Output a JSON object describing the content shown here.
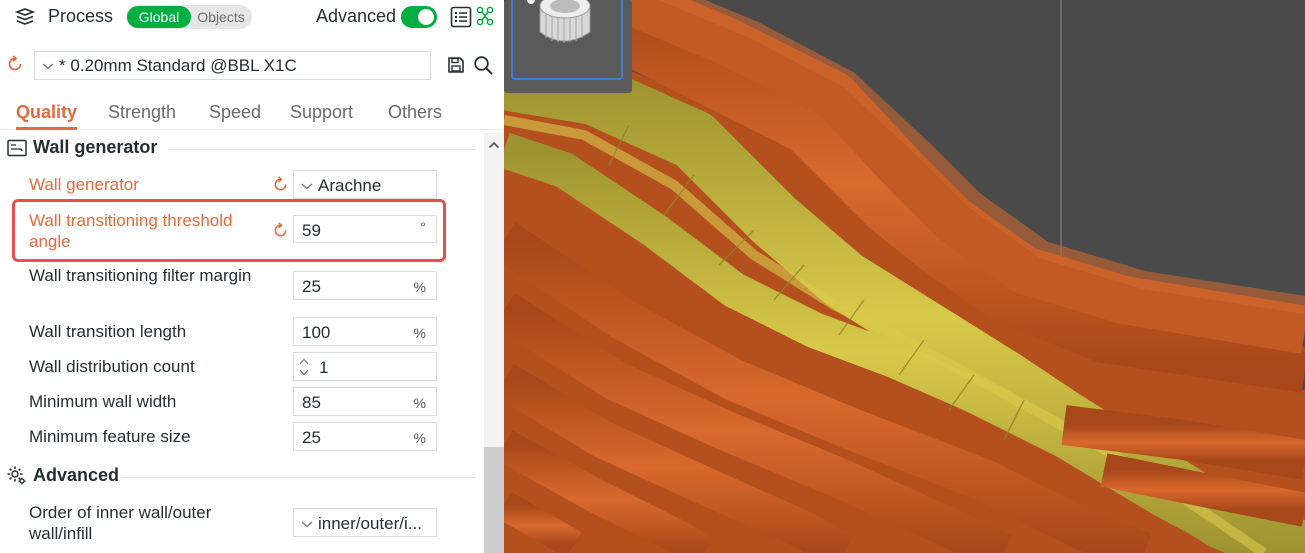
{
  "header": {
    "title": "Process",
    "scope_options": [
      "Global",
      "Objects"
    ],
    "scope_selected": "Global",
    "advanced_label": "Advanced",
    "advanced_on": true
  },
  "preset": {
    "name": "* 0.20mm Standard @BBL X1C"
  },
  "tabs": [
    {
      "label": "Quality",
      "active": true
    },
    {
      "label": "Strength",
      "active": false
    },
    {
      "label": "Speed",
      "active": false
    },
    {
      "label": "Support",
      "active": false
    },
    {
      "label": "Others",
      "active": false
    }
  ],
  "sections": {
    "wall_generator": {
      "title": "Wall generator",
      "rows": [
        {
          "label": "Wall generator",
          "value": "Arachne",
          "unit": "",
          "modified": true,
          "control": "dropdown"
        },
        {
          "label": "Wall transitioning threshold angle",
          "value": "59",
          "unit": "°",
          "modified": true,
          "control": "number"
        },
        {
          "label": "Wall transitioning filter margin",
          "value": "25",
          "unit": "%",
          "modified": false,
          "control": "number"
        },
        {
          "label": "Wall transition length",
          "value": "100",
          "unit": "%",
          "modified": false,
          "control": "number"
        },
        {
          "label": "Wall distribution count",
          "value": "1",
          "unit": "",
          "modified": false,
          "control": "spin"
        },
        {
          "label": "Minimum wall width",
          "value": "85",
          "unit": "%",
          "modified": false,
          "control": "number"
        },
        {
          "label": "Minimum feature size",
          "value": "25",
          "unit": "%",
          "modified": false,
          "control": "number"
        }
      ]
    },
    "advanced": {
      "title": "Advanced",
      "rows": [
        {
          "label": "Order of inner wall/outer wall/infill",
          "value": "inner/outer/i...",
          "unit": "",
          "modified": false,
          "control": "dropdown"
        }
      ]
    }
  },
  "colors": {
    "accent_green": "#00ae42",
    "modified_orange": "#e46a3d",
    "highlight_red": "#e84f4f",
    "outer_wall": "#c85a22",
    "inner_wall": "#c9b83c",
    "viewport_bg": "#4a4a4a"
  },
  "icons": {
    "process": "layers-icon",
    "list": "list-icon",
    "compare": "compare-icon",
    "reset": "reset-arrow-icon",
    "save": "save-icon",
    "search": "search-icon",
    "section_wall": "wall-generator-icon",
    "section_advanced": "gear-icon"
  }
}
